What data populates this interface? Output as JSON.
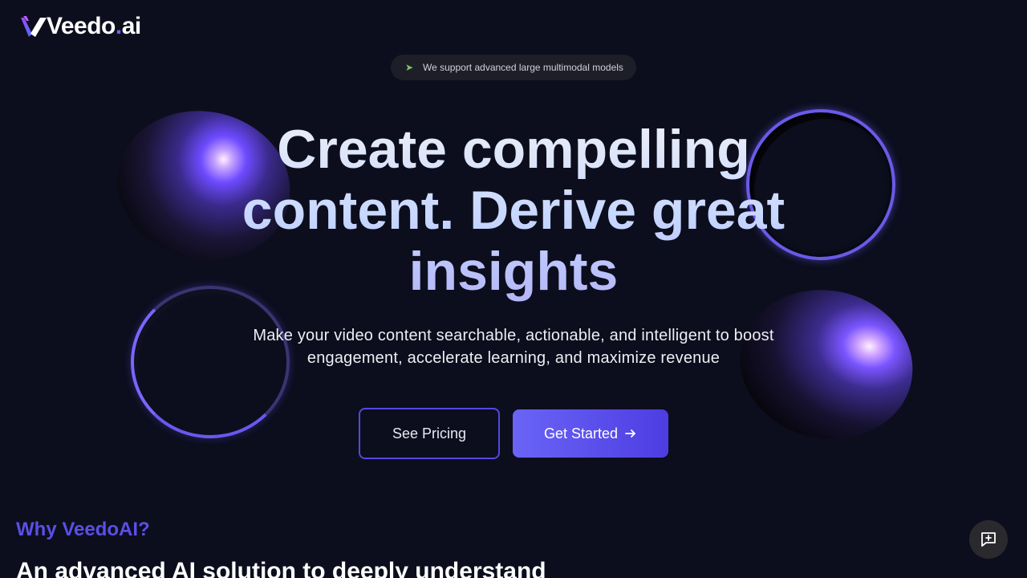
{
  "brand": {
    "logo_text_main": "Veedo",
    "logo_text_dot": ".",
    "logo_text_suffix": "ai",
    "logo_icon": "veedo-v-logo-icon",
    "accent_color": "#6c63ff"
  },
  "announcement": {
    "icon": "rocket-icon",
    "text": "We support advanced large multimodal models"
  },
  "hero": {
    "headline_line1": "Create compelling",
    "headline_line2": "content. Derive great",
    "headline_line3": "insights",
    "subheadline_line1": "Make your video content searchable, actionable, and intelligent to boost",
    "subheadline_line2": "engagement, accelerate learning, and maximize revenue"
  },
  "cta": {
    "secondary_label": "See Pricing",
    "primary_label": "Get Started",
    "primary_icon": "arrow-right-icon",
    "primary_color": "#5a4ff0"
  },
  "why": {
    "label": "Why VeedoAI?",
    "heading": "An advanced AI solution to deeply understand"
  },
  "chat": {
    "icon": "message-plus-icon"
  }
}
